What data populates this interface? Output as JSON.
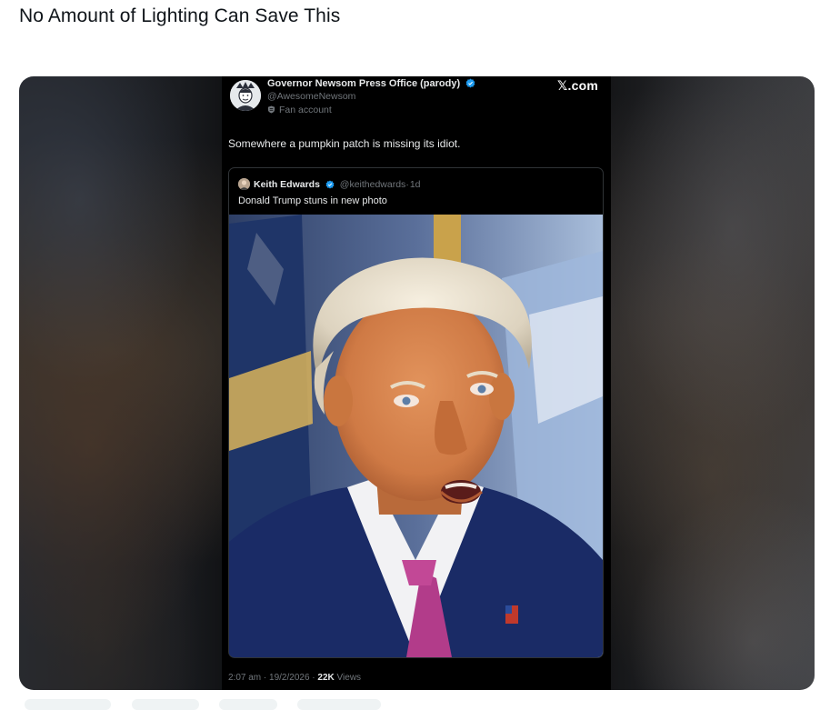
{
  "post": {
    "title": "No Amount of Lighting Can Save This"
  },
  "tweet": {
    "author_name": "Governor Newsom Press Office (parody)",
    "author_handle": "@AwesomeNewsom",
    "account_label": "Fan account",
    "brand": "𝕏.com",
    "text": "Somewhere a pumpkin patch is missing its idiot.",
    "quote": {
      "author_name": "Keith Edwards",
      "author_handle": "@keithedwards",
      "age": "1d",
      "text": "Donald Trump stuns in new photo"
    },
    "timestamp": "2:07 am · 19/2/2026 · ",
    "views_count": "22K",
    "views_label": "Views"
  },
  "colors": {
    "verified_blue": "#1d9bf0",
    "tweet_bg": "#000000",
    "secondary_text": "#71767b"
  },
  "icons": {
    "verified": "verified-badge-icon",
    "fan_account": "shield-icon"
  }
}
